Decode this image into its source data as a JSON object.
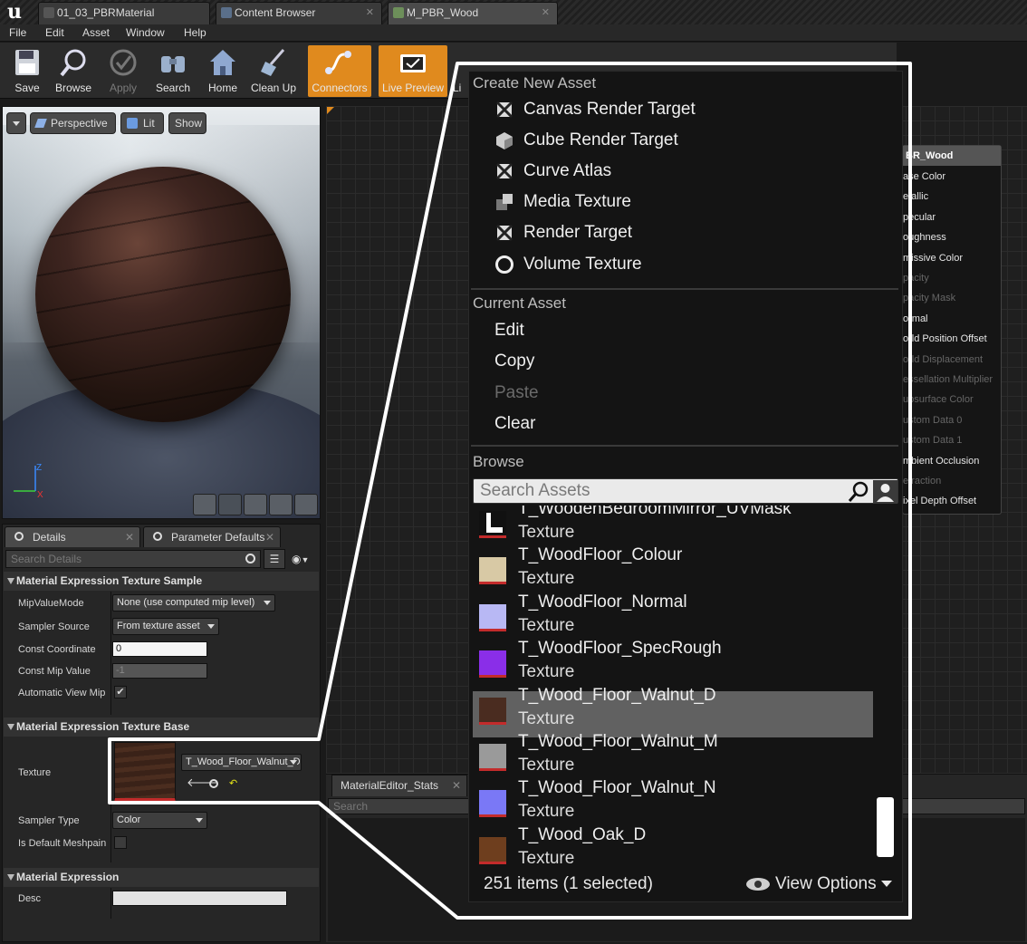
{
  "tabs": [
    {
      "label": "01_03_PBRMaterial"
    },
    {
      "label": "Content Browser"
    },
    {
      "label": "M_PBR_Wood"
    }
  ],
  "menu": [
    "File",
    "Edit",
    "Asset",
    "Window",
    "Help"
  ],
  "toolbar": [
    "Save",
    "Browse",
    "Apply",
    "Search",
    "Home",
    "Clean Up",
    "Connectors",
    "Live Preview",
    "Li"
  ],
  "viewport": {
    "perspective": "Perspective",
    "lit": "Lit",
    "show": "Show"
  },
  "details": {
    "tab_details": "Details",
    "tab_params": "Parameter Defaults",
    "search_placeholder": "Search Details",
    "sections": {
      "texture_sample": "Material Expression Texture Sample",
      "texture_base": "Material Expression Texture Base",
      "expression": "Material Expression"
    },
    "props": {
      "mip_value_mode": {
        "label": "MipValueMode",
        "value": "None (use computed mip level)"
      },
      "sampler_source": {
        "label": "Sampler Source",
        "value": "From texture asset"
      },
      "const_coordinate": {
        "label": "Const Coordinate",
        "value": "0"
      },
      "const_mip_value": {
        "label": "Const Mip Value",
        "value": "-1"
      },
      "auto_view_mip": {
        "label": "Automatic View Mip",
        "checked": true
      },
      "texture": {
        "label": "Texture",
        "value": "T_Wood_Floor_Walnut_D"
      },
      "sampler_type": {
        "label": "Sampler Type",
        "value": "Color"
      },
      "is_default_meshpaint": {
        "label": "Is Default Meshpain",
        "checked": false
      },
      "desc": {
        "label": "Desc",
        "value": ""
      }
    }
  },
  "node": {
    "title": "BR_Wood",
    "pins": [
      {
        "label": "ase Color",
        "enabled": true
      },
      {
        "label": "etallic",
        "enabled": true
      },
      {
        "label": "pecular",
        "enabled": true
      },
      {
        "label": "oughness",
        "enabled": true
      },
      {
        "label": "missive Color",
        "enabled": true
      },
      {
        "label": "pacity",
        "enabled": false
      },
      {
        "label": "pacity Mask",
        "enabled": false
      },
      {
        "label": "ormal",
        "enabled": true
      },
      {
        "label": "orld Position Offset",
        "enabled": true
      },
      {
        "label": "orld Displacement",
        "enabled": false
      },
      {
        "label": "essellation Multiplier",
        "enabled": false
      },
      {
        "label": "ubsurface Color",
        "enabled": false
      },
      {
        "label": "ustom Data 0",
        "enabled": false
      },
      {
        "label": "ustom Data 1",
        "enabled": false
      },
      {
        "label": "mbient Occlusion",
        "enabled": true
      },
      {
        "label": "efraction",
        "enabled": false
      },
      {
        "label": "ixel Depth Offset",
        "enabled": true
      }
    ]
  },
  "stats": {
    "tab": "MaterialEditor_Stats",
    "search_placeholder": "Search"
  },
  "popup": {
    "create_header": "Create New Asset",
    "create_items": [
      "Canvas Render Target",
      "Cube Render Target",
      "Curve Atlas",
      "Media Texture",
      "Render Target",
      "Volume Texture"
    ],
    "current_header": "Current Asset",
    "current_items": [
      {
        "label": "Edit",
        "enabled": true
      },
      {
        "label": "Copy",
        "enabled": true
      },
      {
        "label": "Paste",
        "enabled": false
      },
      {
        "label": "Clear",
        "enabled": true
      }
    ],
    "browse_header": "Browse",
    "search_placeholder": "Search Assets",
    "assets": [
      {
        "name": "T_WoodenBedroomMirror_UVMask",
        "type": "Texture",
        "thumb": "#e8e8e8",
        "selected": false
      },
      {
        "name": "T_WoodFloor_Colour",
        "type": "Texture",
        "thumb": "#d8c9a5",
        "selected": false
      },
      {
        "name": "T_WoodFloor_Normal",
        "type": "Texture",
        "thumb": "#b8b8f4",
        "selected": false
      },
      {
        "name": "T_WoodFloor_SpecRough",
        "type": "Texture",
        "thumb": "#8a2ee8",
        "selected": false
      },
      {
        "name": "T_Wood_Floor_Walnut_D",
        "type": "Texture",
        "thumb": "#4a2c20",
        "selected": true
      },
      {
        "name": "T_Wood_Floor_Walnut_M",
        "type": "Texture",
        "thumb": "#9a9a9a",
        "selected": false
      },
      {
        "name": "T_Wood_Floor_Walnut_N",
        "type": "Texture",
        "thumb": "#7a78f6",
        "selected": false
      },
      {
        "name": "T_Wood_Oak_D",
        "type": "Texture",
        "thumb": "#6e3e1e",
        "selected": false
      }
    ],
    "item_count": "251 items (1 selected)",
    "view_options": "View Options"
  },
  "colors": {
    "accent_orange": "#e08a1e",
    "selection_gray": "#616161",
    "callout_white": "#ffffff"
  }
}
